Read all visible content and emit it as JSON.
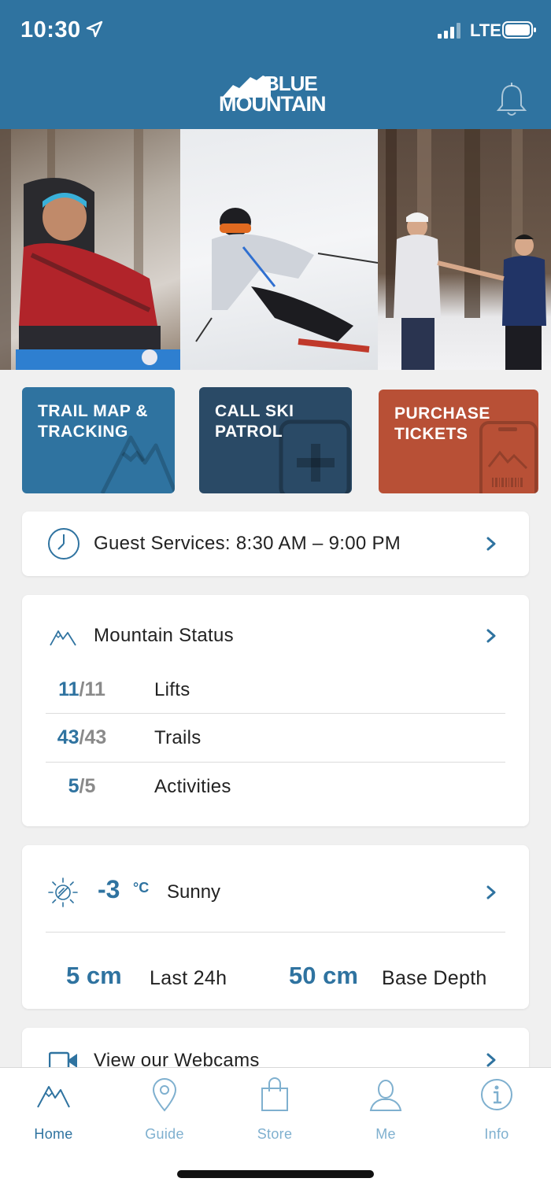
{
  "status_bar": {
    "time": "10:30",
    "network": "LTE"
  },
  "brand": {
    "line1": "BLUE",
    "line2": "MOUNTAIN"
  },
  "tiles": [
    {
      "label": "TRAIL MAP & TRACKING"
    },
    {
      "label": "CALL SKI PATROL"
    },
    {
      "label": "PURCHASE TICKETS"
    }
  ],
  "guest_services": {
    "text": "Guest Services: 8:30 AM – 9:00 PM"
  },
  "mountain_status": {
    "title": "Mountain Status",
    "rows": [
      {
        "open": "11",
        "total": "/11",
        "label": "Lifts"
      },
      {
        "open": "43",
        "total": "/43",
        "label": "Trails"
      },
      {
        "open": "5",
        "total": "/5",
        "label": "Activities"
      }
    ]
  },
  "weather": {
    "temp": "-3",
    "unit": "°C",
    "condition": "Sunny",
    "snow_24h": "5 cm",
    "snow_24h_label": "Last 24h",
    "base_depth": "50 cm",
    "base_depth_label": "Base Depth"
  },
  "webcams": {
    "text": "View our Webcams"
  },
  "tabs": [
    {
      "label": "Home",
      "icon": "mountain-icon",
      "active": true
    },
    {
      "label": "Guide",
      "icon": "map-pin-icon",
      "active": false
    },
    {
      "label": "Store",
      "icon": "shopping-bag-icon",
      "active": false
    },
    {
      "label": "Me",
      "icon": "person-icon",
      "active": false
    },
    {
      "label": "Info",
      "icon": "info-icon",
      "active": false
    }
  ],
  "colors": {
    "brand_blue": "#2f73a0",
    "patrol_navy": "#2a4a66",
    "tickets_red": "#b85036",
    "tab_inactive": "#7fb0cf"
  }
}
